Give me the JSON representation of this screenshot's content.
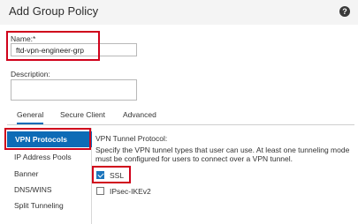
{
  "dialog": {
    "title": "Add Group Policy",
    "help_icon_glyph": "?"
  },
  "name_field": {
    "label": "Name:*",
    "value": "ftd-vpn-engineer-grp"
  },
  "description_field": {
    "label": "Description:",
    "value": ""
  },
  "tabs": [
    {
      "label": "General",
      "active": true
    },
    {
      "label": "Secure Client",
      "active": false
    },
    {
      "label": "Advanced",
      "active": false
    }
  ],
  "side_nav": [
    {
      "label": "VPN Protocols",
      "selected": true
    },
    {
      "label": "IP Address Pools",
      "selected": false
    },
    {
      "label": "Banner",
      "selected": false
    },
    {
      "label": "DNS/WINS",
      "selected": false
    },
    {
      "label": "Split Tunneling",
      "selected": false
    }
  ],
  "vpn_protocols": {
    "heading": "VPN Tunnel Protocol:",
    "description": "Specify the VPN tunnel types that user can use. At least one tunneling mode must be configured for users to connect over a VPN tunnel.",
    "options": [
      {
        "label": "SSL",
        "checked": true
      },
      {
        "label": "IPsec-IKEv2",
        "checked": false
      }
    ]
  },
  "colors": {
    "accent": "#0d6bb6",
    "highlight": "#d0021b"
  }
}
